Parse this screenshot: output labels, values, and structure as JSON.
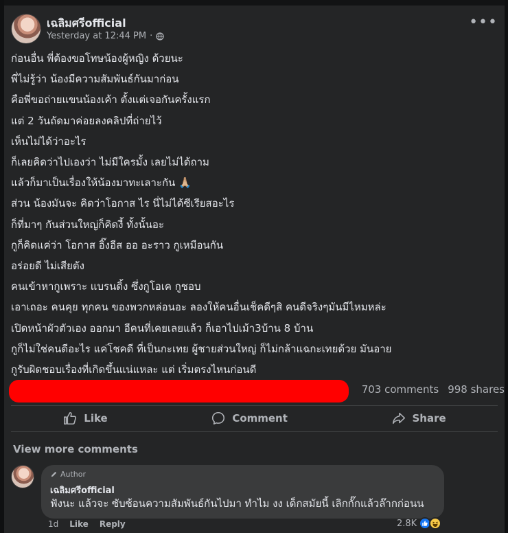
{
  "post": {
    "author": "เฉลิมศรีofficial",
    "timestamp": "Yesterday at 12:44 PM",
    "separator": "·",
    "lines": [
      "ก่อนอื่น พี่ต้องขอโทษน้องผู้หญิง ด้วยนะ",
      "พี่ไม่รู้ว่า น้องมีความสัมพันธ์กันมาก่อน",
      "คือพี่ขอถ่ายแขนน้องเค้า ตั้งแต่เจอกันครั้งแรก",
      "แต่ 2 วันถัดมาค่อยลงคลิปที่ถ่ายไว้",
      "เห็นไม่ได้ว่าอะไร",
      "ก็เลยคิดว่าไปเองว่า ไม่มีใครมั้ง เลยไม่ได้ถาม",
      "แล้วก็มาเป็นเรื่องให้น้องมาทะเลาะกัน 🙏🏼",
      "ส่วน น้องมันจะ คิดว่าโอกาส ไร นี่ไม่ได้ซีเรียสอะไร",
      "ก็ที่มาๆ กันส่วนใหญ่ก็คิดงี้ ทั้งนั้นอะ",
      "กูก็คิดแค่ว่า โอกาส อิ๊งอีส ออ อะราว กูเหมือนกัน",
      "อร่อยดี ไม่เสียตัง",
      "คนเข้าหากูเพราะ แบรนดิ้ง ซึ่งกูโอเค กูชอบ",
      "เอาเถอะ คนคุย ทุกคน ของพวกหล่อนอะ ลองให้คนอื่นเช็คดีๆสิ  คนดีจริงๆมันมีไหมหล่ะ",
      "เปิดหน้าผัวตัวเอง ออกมา อีคนที่เคยเลยแล้ว ก็เอาไปเม้า3บ้าน 8 บ้าน",
      "กูก็ไม่ใช่คนดีอะไร แค่โชคดี ที่เป็นกะเทย ผู้ชายส่วนใหญ่ ก็ไม่กล้าแฉกะเทยด้วย มันอาย",
      "กูรับผิดชอบเรื่องที่เกิดขึ้นแน่แหละ แต่ เริ่มตรงไหนก่อนดี"
    ]
  },
  "stats": {
    "comments": "703 comments",
    "shares": "998 shares"
  },
  "actions": {
    "like": "Like",
    "comment": "Comment",
    "share": "Share"
  },
  "view_more": "View more comments",
  "comment": {
    "badge": "Author",
    "author": "เฉลิมศรีofficial",
    "text": "ฟังนะ แล้วจะ ซับซ้อนความสัมพันธ์กันไปมา ทำไม งง เด็กสมัยนี้ เลิกกั๊กแล้วล๊ากก่อนน",
    "age": "1d",
    "like": "Like",
    "reply": "Reply",
    "reaction_count": "2.8K"
  },
  "icons": {
    "globe": "globe-icon",
    "more": "more-options-icon",
    "like": "thumbs-up-icon",
    "comment": "comment-bubble-icon",
    "share": "share-arrow-icon",
    "author_badge": "pencil-icon",
    "react_like": "like-reaction-icon",
    "react_haha": "haha-reaction-icon"
  },
  "colors": {
    "background": "#242526",
    "text": "#e4e6eb",
    "muted": "#b0b3b8",
    "redaction": "#ff0000",
    "like_blue": "#1877f2"
  }
}
